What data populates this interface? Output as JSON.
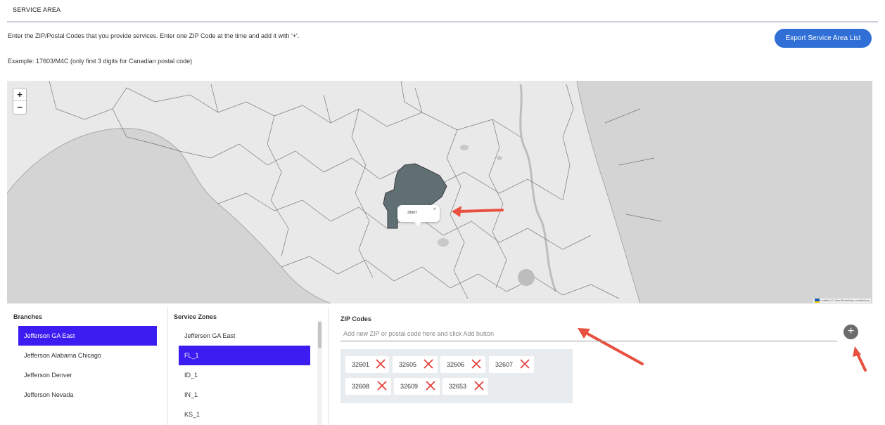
{
  "header": {
    "title": "SERVICE AREA",
    "instructions": "Enter the ZIP/Postal Codes that you provide services. Enter one ZIP Code at the time and add it with '+'.",
    "example": "Example: 17603/M4C (only first 3 digits for Canadian postal code)",
    "export_label": "Export Service Area List"
  },
  "map": {
    "zoom_in": "+",
    "zoom_out": "−",
    "popup_zip": "32607",
    "popup_close": "×",
    "attribution": "Leaflet | © OpenStreetMap contributors"
  },
  "branches": {
    "title": "Branches",
    "items": [
      "Jefferson GA East",
      "Jefferson Alabama Chicago",
      "Jefferson Denver",
      "Jefferson Nevada"
    ],
    "selected": "Jefferson GA East"
  },
  "zones": {
    "title": "Service Zones",
    "items": [
      "Jefferson GA East",
      "FL_1",
      "ID_1",
      "IN_1",
      "KS_1"
    ],
    "selected": "FL_1"
  },
  "zip": {
    "title": "ZIP Codes",
    "placeholder": "Add new ZIP or postal code here and click Add button",
    "add_symbol": "+",
    "codes": [
      "32601",
      "32605",
      "32606",
      "32607",
      "32608",
      "32609",
      "32653"
    ]
  },
  "colors": {
    "accent": "#2f6fd6",
    "selected": "#3b1df2",
    "highlight_region": "#5f6f73",
    "arrow": "#e8503f",
    "remove_x": "#e53935"
  }
}
